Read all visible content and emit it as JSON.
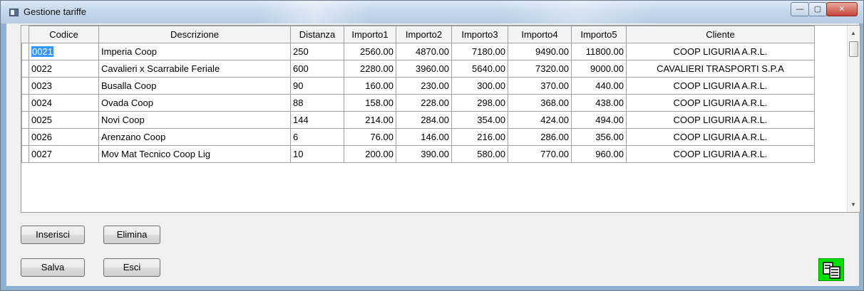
{
  "window": {
    "title": "Gestione tariffe"
  },
  "controls": {
    "minimize": "—",
    "maximize": "▢",
    "close": "✕"
  },
  "grid": {
    "columns": [
      "Codice",
      "Descrizione",
      "Distanza",
      "Importo1",
      "Importo2",
      "Importo3",
      "Importo4",
      "Importo5",
      "Cliente"
    ],
    "rows": [
      [
        "0021",
        "Imperia Coop",
        "250",
        "2560.00",
        "4870.00",
        "7180.00",
        "9490.00",
        "11800.00",
        "COOP LIGURIA A.R.L."
      ],
      [
        "0022",
        "Cavalieri x Scarrabile Feriale",
        "600",
        "2280.00",
        "3960.00",
        "5640.00",
        "7320.00",
        "9000.00",
        "CAVALIERI TRASPORTI S.P.A"
      ],
      [
        "0023",
        "Busalla Coop",
        "90",
        "160.00",
        "230.00",
        "300.00",
        "370.00",
        "440.00",
        "COOP LIGURIA A.R.L."
      ],
      [
        "0024",
        "Ovada Coop",
        "88",
        "158.00",
        "228.00",
        "298.00",
        "368.00",
        "438.00",
        "COOP LIGURIA A.R.L."
      ],
      [
        "0025",
        "Novi Coop",
        "144",
        "214.00",
        "284.00",
        "354.00",
        "424.00",
        "494.00",
        "COOP LIGURIA A.R.L."
      ],
      [
        "0026",
        "Arenzano Coop",
        "6",
        "76.00",
        "146.00",
        "216.00",
        "286.00",
        "356.00",
        "COOP LIGURIA A.R.L."
      ],
      [
        "0027",
        "Mov Mat Tecnico Coop Lig",
        "10",
        "200.00",
        "390.00",
        "580.00",
        "770.00",
        "960.00",
        "COOP LIGURIA A.R.L."
      ]
    ],
    "selected_cell": "0021"
  },
  "buttons": {
    "inserisci": "Inserisci",
    "elimina": "Elimina",
    "salva": "Salva",
    "esci": "Esci"
  },
  "icons": {
    "copy": "copy-icon",
    "accent": "#00e000"
  }
}
